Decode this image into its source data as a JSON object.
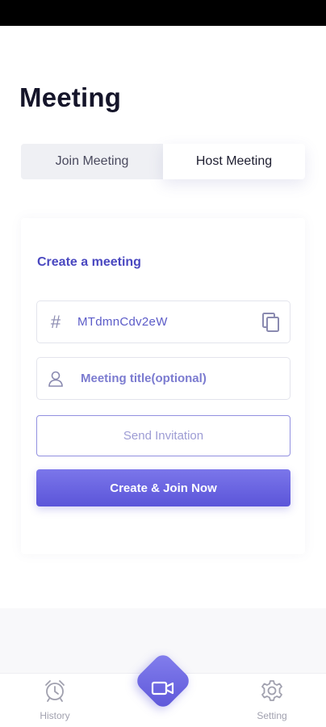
{
  "page": {
    "title": "Meeting"
  },
  "tabs": [
    {
      "label": "Join Meeting",
      "active": false
    },
    {
      "label": "Host Meeting",
      "active": true
    }
  ],
  "card": {
    "section_title": "Create a meeting",
    "meeting_code": "MTdmnCdv2eW",
    "title_placeholder": "Meeting title(optional)",
    "send_label": "Send Invitation",
    "create_label": "Create & Join Now"
  },
  "nav": {
    "history_label": "History",
    "setting_label": "Setting",
    "center_icon": "video-camera-icon"
  },
  "colors": {
    "accent": "#5b55d9",
    "accent_text": "#4a48c0",
    "muted": "#a0a0ae"
  }
}
